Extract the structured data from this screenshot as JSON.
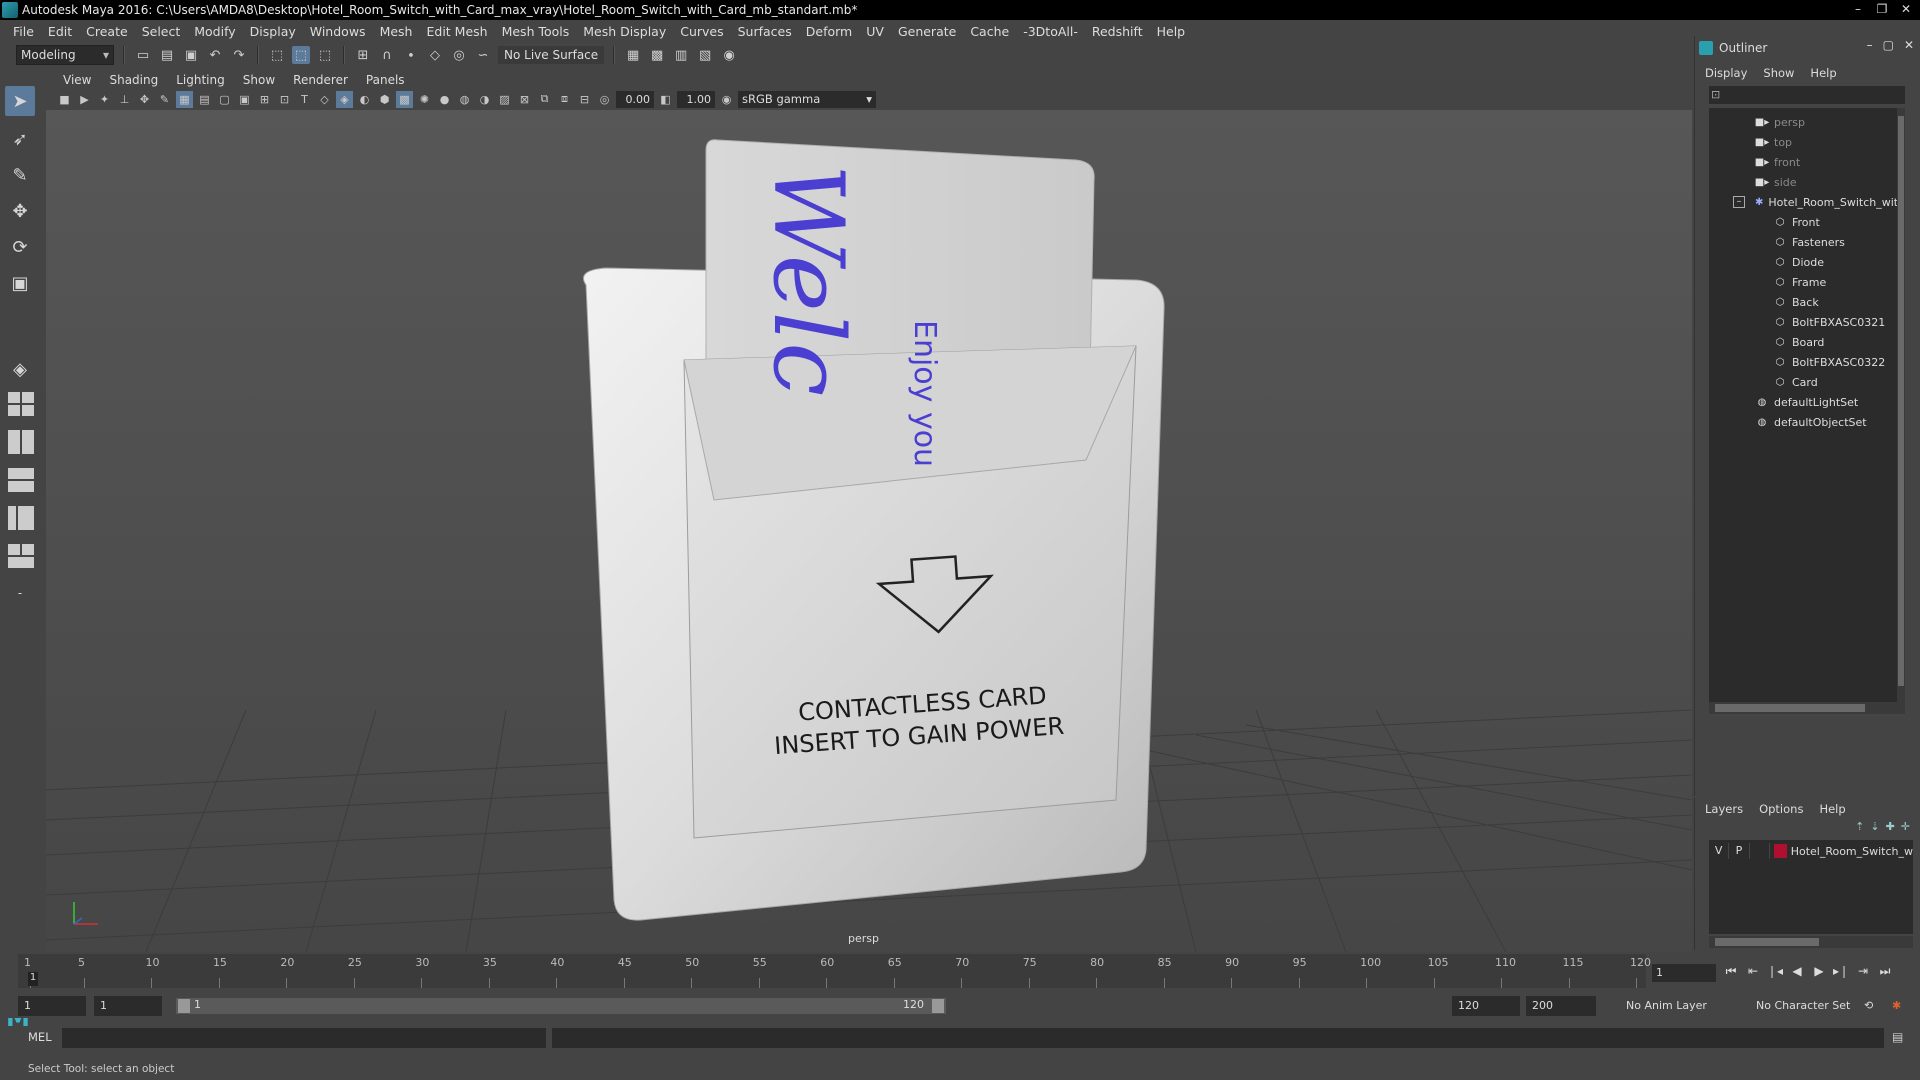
{
  "window": {
    "title": "Autodesk Maya 2016: C:\\Users\\AMDA8\\Desktop\\Hotel_Room_Switch_with_Card_max_vray\\Hotel_Room_Switch_with_Card_mb_standart.mb*",
    "controls": [
      "–",
      "❐",
      "✕"
    ]
  },
  "menubar": [
    "File",
    "Edit",
    "Create",
    "Select",
    "Modify",
    "Display",
    "Windows",
    "Mesh",
    "Edit Mesh",
    "Mesh Tools",
    "Mesh Display",
    "Curves",
    "Surfaces",
    "Deform",
    "UV",
    "Generate",
    "Cache",
    "-3DtoAll-",
    "Redshift",
    "Help"
  ],
  "statusline": {
    "mode": "Modeling",
    "live_surface": "No Live Surface"
  },
  "panel": {
    "menu": [
      "View",
      "Shading",
      "Lighting",
      "Show",
      "Renderer",
      "Panels"
    ],
    "exposure": "0.00",
    "gamma": "1.00",
    "color_space": "sRGB gamma",
    "camera_label": "persp"
  },
  "scene": {
    "card_text_big": "Welc",
    "card_text_small": "Enjoy you",
    "switch_line1": "CONTACTLESS CARD",
    "switch_line2": "INSERT TO GAIN POWER"
  },
  "timeline": {
    "ticks": [
      "1",
      "5",
      "10",
      "15",
      "20",
      "25",
      "30",
      "35",
      "40",
      "45",
      "50",
      "55",
      "60",
      "65",
      "70",
      "75",
      "80",
      "85",
      "90",
      "95",
      "100",
      "105",
      "110",
      "115",
      "120"
    ],
    "current_frame": "1"
  },
  "range": {
    "start": "1",
    "playback_start": "1",
    "slider_start": "1",
    "slider_end": "120",
    "playback_end": "120",
    "end": "200",
    "anim_layer": "No Anim Layer",
    "character_set": "No Character Set"
  },
  "command": {
    "language": "MEL",
    "help_text": "Select Tool: select an object"
  },
  "outliner": {
    "title": "Outliner",
    "menu": [
      "Display",
      "Show",
      "Help"
    ],
    "cameras": [
      "persp",
      "top",
      "front",
      "side"
    ],
    "group": "Hotel_Room_Switch_with_",
    "children": [
      "Front",
      "Fasteners",
      "Diode",
      "Frame",
      "Back",
      "BoltFBXASC0321",
      "Board",
      "BoltFBXASC0322",
      "Card"
    ],
    "sets": [
      "defaultLightSet",
      "defaultObjectSet"
    ]
  },
  "layers": {
    "menu": [
      "Layers",
      "Options",
      "Help"
    ],
    "row": {
      "v": "V",
      "p": "P",
      "name": "Hotel_Room_Switch_w",
      "color": "#b01030"
    }
  },
  "colors": {
    "accent": "#5c7a99",
    "card_text": "#4a3fd0",
    "maya_teal": "#2a9fb0"
  }
}
